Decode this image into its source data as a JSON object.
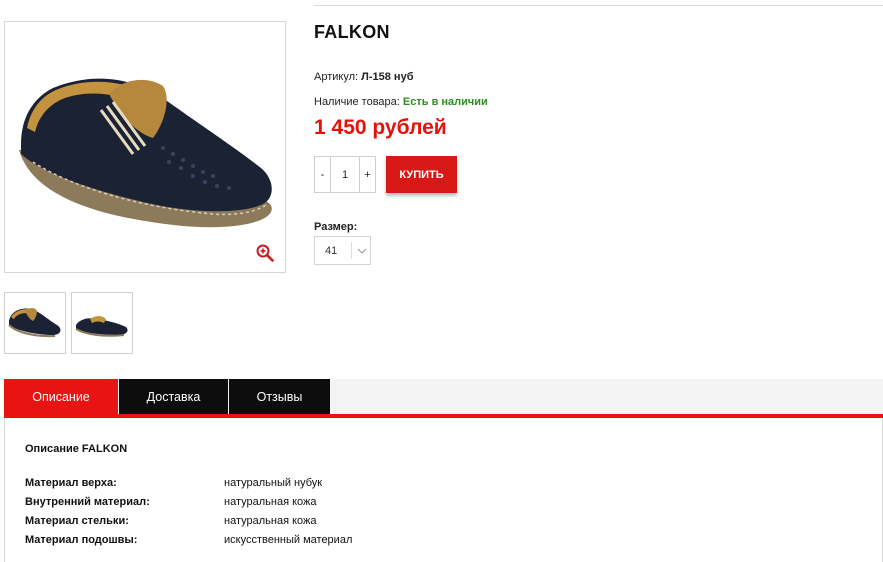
{
  "product": {
    "title": "FALKON",
    "sku_label": "Артикул:",
    "sku_value": "Л-158 нуб",
    "stock_label": "Наличие товара:",
    "stock_value": "Есть в наличии",
    "price": "1 450 рублей",
    "quantity": "1",
    "minus": "-",
    "plus": "+",
    "buy_label": "КУПИТЬ",
    "size_label": "Размер:",
    "size_value": "41"
  },
  "tabs": [
    {
      "label": "Описание",
      "active": true
    },
    {
      "label": "Доставка",
      "active": false
    },
    {
      "label": "Отзывы",
      "active": false
    }
  ],
  "description": {
    "title": "Описание FALKON",
    "specs": [
      {
        "key": "Материал верха:",
        "value": "натуральный нубук"
      },
      {
        "key": "Внутренний материал:",
        "value": "натуральная кожа"
      },
      {
        "key": "Материал стельки:",
        "value": "натуральная кожа"
      },
      {
        "key": "Материал подошвы:",
        "value": "искусственный материал"
      }
    ]
  },
  "icons": {
    "zoom": "zoom-in-icon",
    "chevron": "chevron-down-icon"
  },
  "colors": {
    "accent": "#e81313",
    "price": "#e3120b",
    "stock_ok": "#2e8b22",
    "tab_dark": "#0d0d0d"
  }
}
